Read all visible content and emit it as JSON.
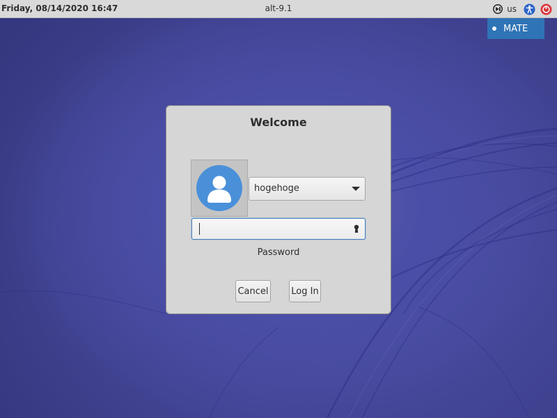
{
  "top_panel": {
    "clock": "Friday, 08/14/2020 16:47",
    "hostname": "alt-9.1",
    "keyboard_layout": "us",
    "icons": {
      "session": "session-icon",
      "accessibility": "accessibility-icon",
      "power": "power-icon"
    }
  },
  "session_menu": {
    "items": [
      {
        "label": "MATE",
        "selected": true
      }
    ]
  },
  "login_dialog": {
    "title": "Welcome",
    "avatar_icon": "user-avatar-icon",
    "user_select": {
      "value": "hogehoge"
    },
    "password": {
      "value": "",
      "label": "Password",
      "caps_icon": "keyhole-icon"
    },
    "buttons": {
      "cancel": "Cancel",
      "login": "Log In"
    }
  },
  "colors": {
    "panel_bg": "#d9d9d9",
    "desktop_bg": "#4b4ea6",
    "dialog_bg": "#d6d6d6",
    "menu_highlight": "#2f74b6",
    "avatar_bg": "#4a90d9",
    "power_red": "#d9393e",
    "a11y_blue": "#2a63c7"
  }
}
